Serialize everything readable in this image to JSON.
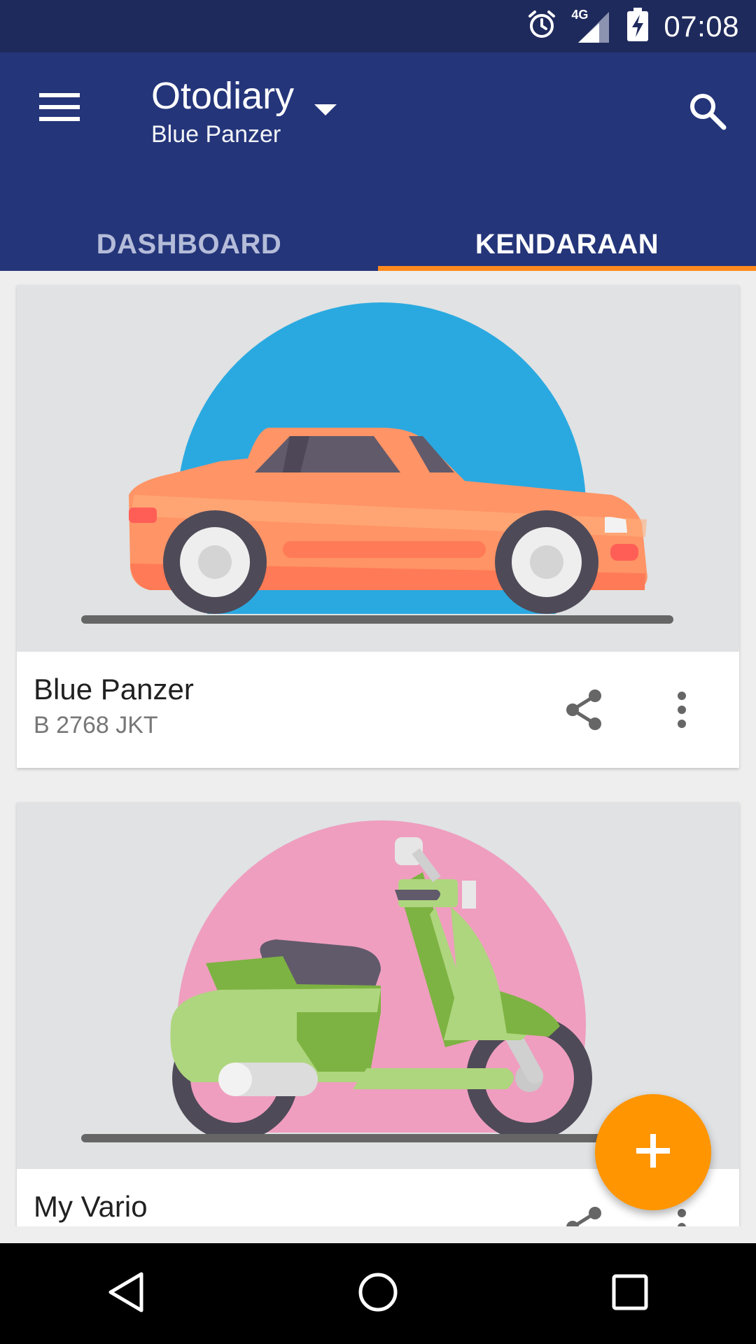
{
  "status_bar": {
    "time": "07:08",
    "network": "4G",
    "icons": [
      "alarm-icon",
      "signal-icon",
      "battery-charging-icon"
    ]
  },
  "app_bar": {
    "title": "Otodiary",
    "subtitle": "Blue Panzer",
    "icons": [
      "menu-icon",
      "dropdown-arrow-icon",
      "search-icon"
    ]
  },
  "tabs": [
    {
      "label": "DASHBOARD",
      "active": false
    },
    {
      "label": "KENDARAAN",
      "active": true
    }
  ],
  "vehicles": [
    {
      "name": "Blue Panzer",
      "plate": "B 2768 JKT",
      "type": "car",
      "circle_color": "#2aa9e0"
    },
    {
      "name": "My Vario",
      "plate": "",
      "type": "scooter",
      "circle_color": "#ef9ebf"
    }
  ],
  "colors": {
    "primary": "#24357a",
    "status": "#1f2a5c",
    "accent": "#ff9500",
    "tab_indicator": "#ff8a1d"
  },
  "fab": {
    "icon": "plus-icon"
  },
  "nav": {
    "icons": [
      "back-icon",
      "home-icon",
      "recents-icon"
    ]
  }
}
